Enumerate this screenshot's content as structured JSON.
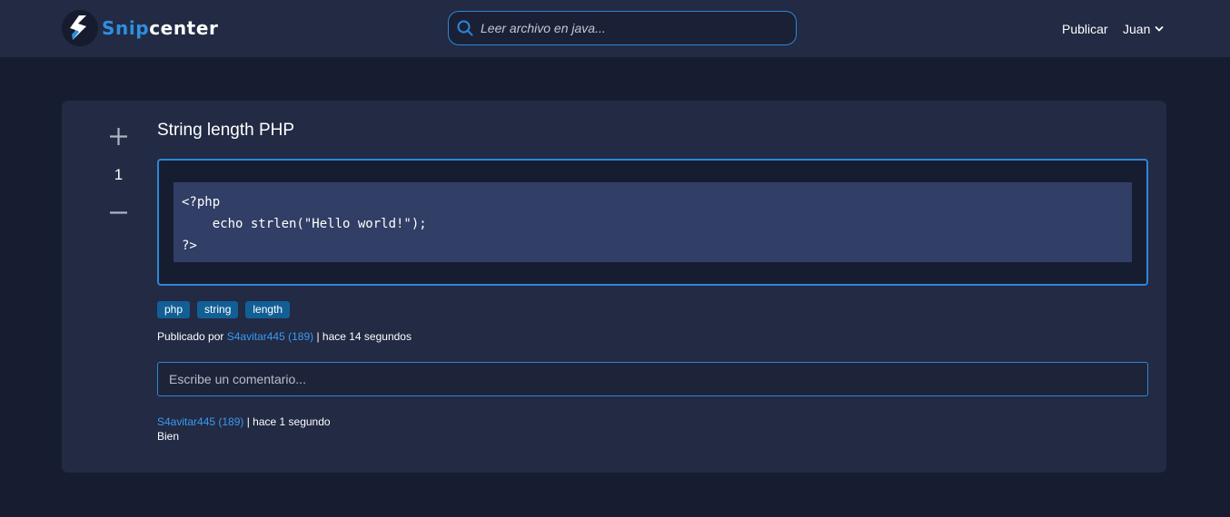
{
  "header": {
    "logo_part1": "Snip",
    "logo_part2": "center",
    "search_placeholder": "Leer archivo en java...",
    "nav_publicar": "Publicar",
    "nav_user": "Juan"
  },
  "colors": {
    "accent": "#2e86d6",
    "link": "#3b9af0",
    "tag_bg": "#125f96",
    "page_bg": "#171d31",
    "panel_bg": "#222a44",
    "code_bg": "#313f66"
  },
  "icons": {
    "logo": "lightning-bolt-icon",
    "search": "search-icon",
    "dropdown": "chevron-down-icon",
    "upvote": "plus-icon",
    "downvote": "minus-icon"
  },
  "post": {
    "vote_count": "1",
    "title": "String length PHP",
    "code": "<?php\n    echo strlen(\"Hello world!\");\n?>",
    "tags": [
      "php",
      "string",
      "length"
    ],
    "published_prefix": "Publicado por ",
    "author_link": "S4avitar445 (189)",
    "published_suffix": " | hace 14 segundos"
  },
  "comments": {
    "input_placeholder": "Escribe un comentario...",
    "items": [
      {
        "author_link": "S4avitar445 (189)",
        "time_suffix": " | hace 1 segundo",
        "body": "Bien"
      }
    ]
  }
}
